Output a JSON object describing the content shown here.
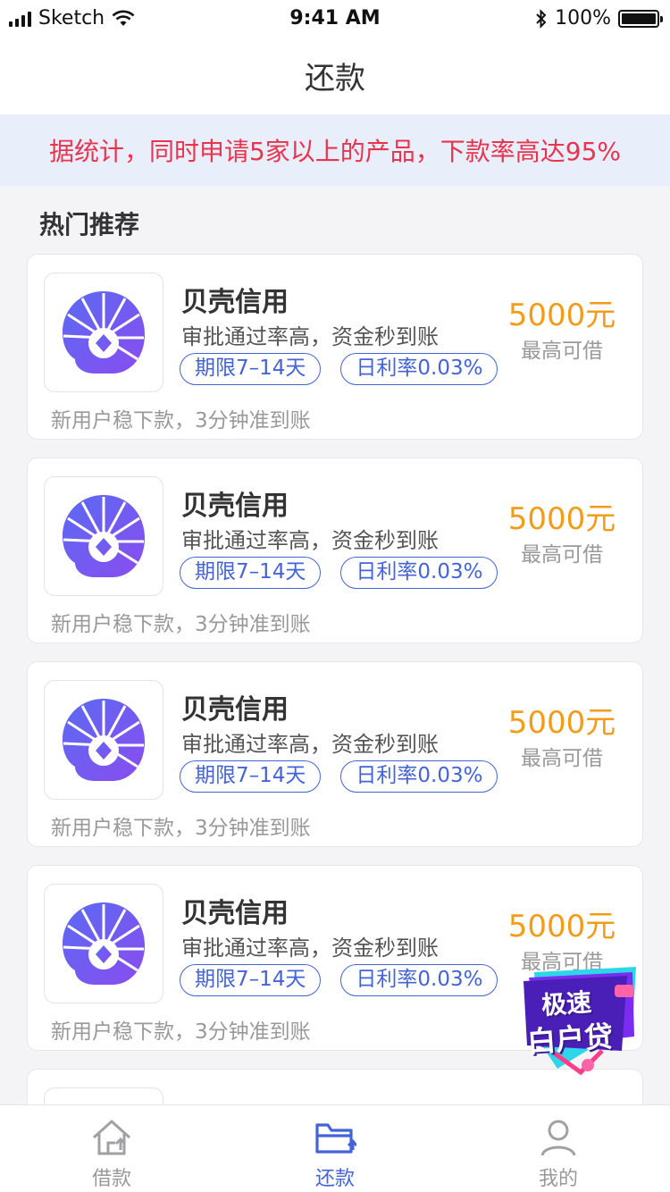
{
  "status_bar": {
    "carrier": "Sketch",
    "time": "9:41 AM",
    "battery": "100%"
  },
  "nav": {
    "title": "还款"
  },
  "notice": {
    "text": "据统计，同时申请5家以上的产品，下款率高达95%"
  },
  "section": {
    "title": "热门推荐"
  },
  "products": [
    {
      "name": "贝壳信用",
      "desc": "审批通过率高，资金秒到账",
      "tags": [
        "期限7–14天",
        "日利率0.03%"
      ],
      "amount": "5000元",
      "amount_label": "最高可借",
      "footer": "新用户稳下款，3分钟准到账"
    },
    {
      "name": "贝壳信用",
      "desc": "审批通过率高，资金秒到账",
      "tags": [
        "期限7–14天",
        "日利率0.03%"
      ],
      "amount": "5000元",
      "amount_label": "最高可借",
      "footer": "新用户稳下款，3分钟准到账"
    },
    {
      "name": "贝壳信用",
      "desc": "审批通过率高，资金秒到账",
      "tags": [
        "期限7–14天",
        "日利率0.03%"
      ],
      "amount": "5000元",
      "amount_label": "最高可借",
      "footer": "新用户稳下款，3分钟准到账"
    },
    {
      "name": "贝壳信用",
      "desc": "审批通过率高，资金秒到账",
      "tags": [
        "期限7–14天",
        "日利率0.03%"
      ],
      "amount": "5000元",
      "amount_label": "最高可借",
      "footer": "新用户稳下款，3分钟准到账"
    }
  ],
  "promo": {
    "line1": "极速",
    "line2": "白户贷"
  },
  "tabs": [
    {
      "label": "借款",
      "icon": "home-upload-icon",
      "active": false
    },
    {
      "label": "还款",
      "icon": "wallet-icon",
      "active": true
    },
    {
      "label": "我的",
      "icon": "user-icon",
      "active": false
    }
  ],
  "colors": {
    "accent": "#4463d8",
    "amount": "#f39c19",
    "notice_text": "#e8344e",
    "notice_bg": "#e9eefb"
  }
}
